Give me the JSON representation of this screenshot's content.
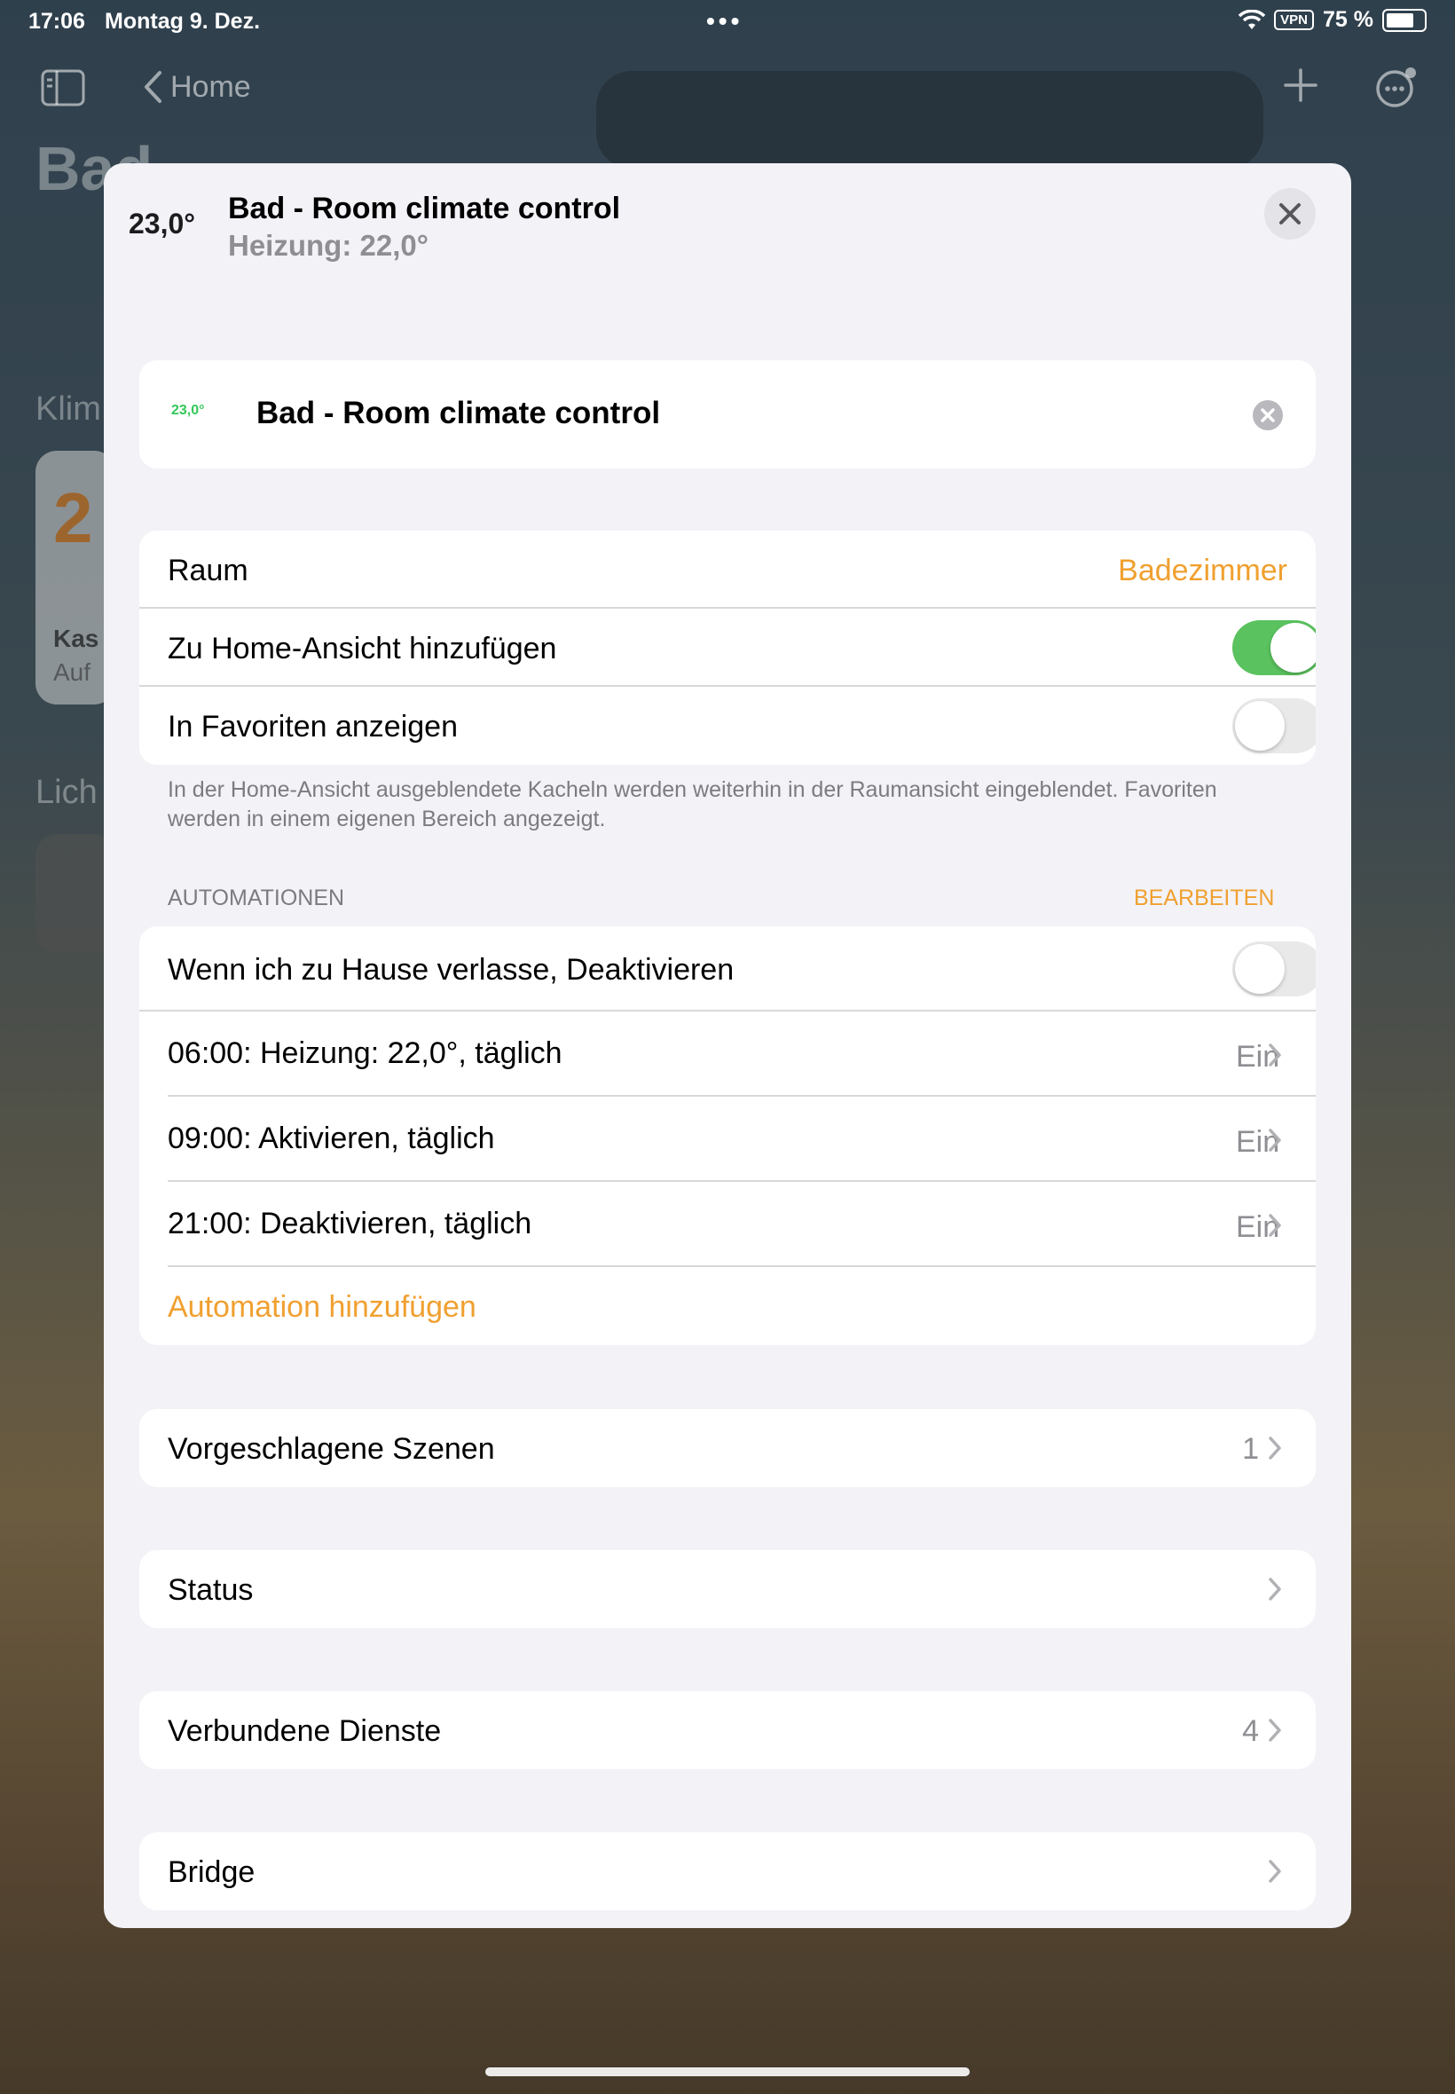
{
  "status_bar": {
    "time": "17:06",
    "date": "Montag 9. Dez.",
    "dots": "•••",
    "vpn": "VPN",
    "battery": "75 %",
    "battery_level": 0.75
  },
  "background": {
    "back_label": "Home",
    "title": "Bad",
    "section_climate": "Klim",
    "tile_temp": "2",
    "tile_title": "Kas",
    "tile_sub": "Auf",
    "section_light": "Lich"
  },
  "header": {
    "temp": "23,0°",
    "title": "Bad - Room climate control",
    "subtitle": "Heizung: 22,0°"
  },
  "name_field": {
    "badge": "23,0°",
    "value": "Bad - Room climate control"
  },
  "settings": {
    "room_label": "Raum",
    "room_value": "Badezimmer",
    "home_view_label": "Zu Home-Ansicht hinzufügen",
    "home_view_on": true,
    "favorites_label": "In Favoriten anzeigen",
    "favorites_on": false
  },
  "footnote": "In der Home-Ansicht ausgeblendete Kacheln werden weiterhin in der Raumansicht eingeblendet. Favoriten werden in einem eigenen Bereich angezeigt.",
  "automations": {
    "header": "AUTOMATIONEN",
    "edit": "BEARBEITEN",
    "leave_home_label": "Wenn ich zu Hause verlasse, Deaktivieren",
    "leave_home_on": false,
    "items": [
      {
        "label": "06:00: Heizung: 22,0°, täglich",
        "value": "Ein"
      },
      {
        "label": "09:00: Aktivieren, täglich",
        "value": "Ein"
      },
      {
        "label": "21:00: Deaktivieren, täglich",
        "value": "Ein"
      }
    ],
    "add": "Automation hinzufügen"
  },
  "scenes": {
    "label": "Vorgeschlagene Szenen",
    "count": "1"
  },
  "status": {
    "label": "Status"
  },
  "connected": {
    "label": "Verbundene Dienste",
    "count": "4"
  },
  "bridge": {
    "label": "Bridge"
  },
  "colors": {
    "accent": "#F0A030",
    "toggle_on": "#5AC25E",
    "badge": "#34C759"
  }
}
